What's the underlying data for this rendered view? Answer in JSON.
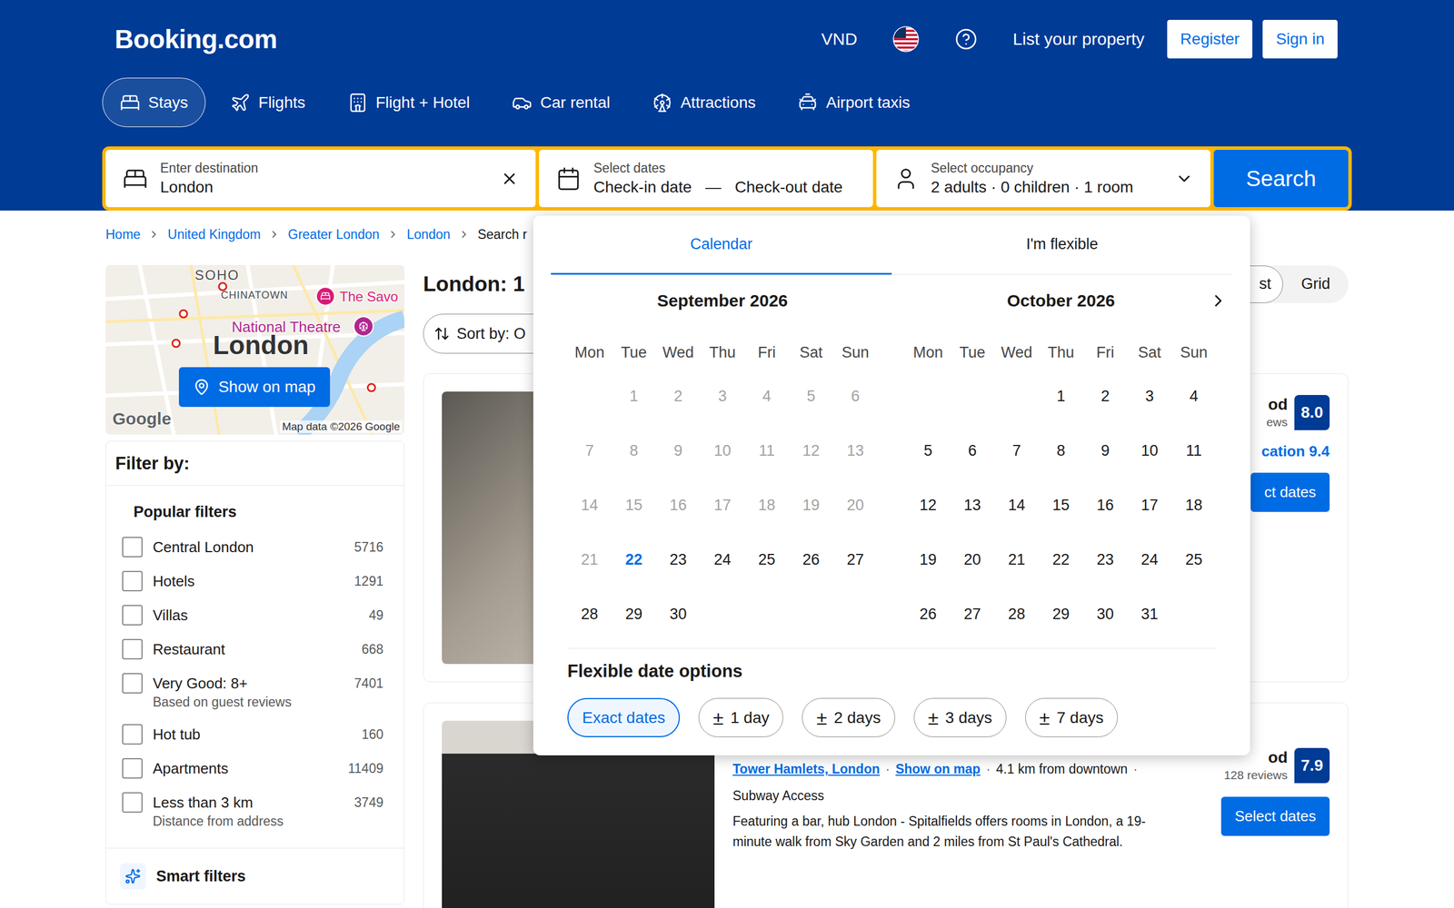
{
  "header": {
    "logo": "Booking.com",
    "currency": "VND",
    "list_property": "List your property",
    "buttons": [
      "Register",
      "Sign in"
    ]
  },
  "nav": [
    {
      "label": "Stays",
      "selected": true
    },
    {
      "label": "Flights",
      "selected": false
    },
    {
      "label": "Flight + Hotel",
      "selected": false
    },
    {
      "label": "Car rental",
      "selected": false
    },
    {
      "label": "Attractions",
      "selected": false
    },
    {
      "label": "Airport taxis",
      "selected": false
    }
  ],
  "search": {
    "destination": {
      "label": "Enter destination",
      "value": "London"
    },
    "dates": {
      "label": "Select dates",
      "checkin": "Check-in date",
      "separator": "—",
      "checkout": "Check-out date"
    },
    "occupancy": {
      "label": "Select occupancy",
      "value": "2 adults · 0 children · 1 room"
    },
    "button": "Search"
  },
  "breadcrumb": [
    "Home",
    "United Kingdom",
    "Greater London",
    "London",
    "Search r"
  ],
  "map": {
    "area_labels": [
      {
        "text": "SOHO"
      },
      {
        "text": "CHINATOWN"
      }
    ],
    "places": [
      {
        "text": "The Savo",
        "color": "#d81b78"
      },
      {
        "text": "National Theatre",
        "color": "#b0268f"
      }
    ],
    "city": "London",
    "button": "Show on map",
    "brand": "Google",
    "attribution": "Map data ©2026 Google"
  },
  "filters": {
    "title": "Filter by:",
    "section": "Popular filters",
    "items": [
      {
        "label": "Central London",
        "count": "5716",
        "checked": false
      },
      {
        "label": "Hotels",
        "count": "1291",
        "checked": false
      },
      {
        "label": "Villas",
        "count": "49",
        "checked": false
      },
      {
        "label": "Restaurant",
        "count": "668",
        "checked": false
      },
      {
        "label": "Very Good: 8+",
        "count": "7401",
        "checked": false,
        "note": "Based on guest reviews"
      },
      {
        "label": "Hot tub",
        "count": "160",
        "checked": false
      },
      {
        "label": "Apartments",
        "count": "11409",
        "checked": false
      },
      {
        "label": "Less than 3 km",
        "count": "3749",
        "checked": false,
        "note": "Distance from address"
      }
    ],
    "smart": "Smart filters"
  },
  "results": {
    "title": "London: 1",
    "sort": "Sort by: O",
    "views": [
      {
        "label": "st",
        "selected": true
      },
      {
        "label": "Grid",
        "selected": false
      }
    ],
    "cards": [
      {
        "score_word": "od",
        "reviews": "ews",
        "score": "8.0",
        "sub_score": "cation 9.4",
        "button": "ct dates"
      },
      {
        "location": "Tower Hamlets, London",
        "map_link": "Show on map",
        "distance": "4.1 km from downtown",
        "separator": "·",
        "tag": "Subway Access",
        "description": "Featuring a bar, hub London - Spitalfields offers rooms in London, a 19-minute walk from Sky Garden and 2 miles from St Paul's Cathedral.",
        "score_word": "od",
        "reviews": "128 reviews",
        "score": "7.9",
        "button": "Select dates"
      }
    ]
  },
  "calendar": {
    "tabs": [
      {
        "label": "Calendar",
        "selected": true
      },
      {
        "label": "I'm flexible",
        "selected": false
      }
    ],
    "weekdays": [
      "Mon",
      "Tue",
      "Wed",
      "Thu",
      "Fri",
      "Sat",
      "Sun"
    ],
    "months": [
      {
        "title": "September 2026",
        "offset": 1,
        "days": [
          {
            "label": "1",
            "disabled": true,
            "today": false
          },
          {
            "label": "2",
            "disabled": true,
            "today": false
          },
          {
            "label": "3",
            "disabled": true,
            "today": false
          },
          {
            "label": "4",
            "disabled": true,
            "today": false
          },
          {
            "label": "5",
            "disabled": true,
            "today": false
          },
          {
            "label": "6",
            "disabled": true,
            "today": false
          },
          {
            "label": "7",
            "disabled": true,
            "today": false
          },
          {
            "label": "8",
            "disabled": true,
            "today": false
          },
          {
            "label": "9",
            "disabled": true,
            "today": false
          },
          {
            "label": "10",
            "disabled": true,
            "today": false
          },
          {
            "label": "11",
            "disabled": true,
            "today": false
          },
          {
            "label": "12",
            "disabled": true,
            "today": false
          },
          {
            "label": "13",
            "disabled": true,
            "today": false
          },
          {
            "label": "14",
            "disabled": true,
            "today": false
          },
          {
            "label": "15",
            "disabled": true,
            "today": false
          },
          {
            "label": "16",
            "disabled": true,
            "today": false
          },
          {
            "label": "17",
            "disabled": true,
            "today": false
          },
          {
            "label": "18",
            "disabled": true,
            "today": false
          },
          {
            "label": "19",
            "disabled": true,
            "today": false
          },
          {
            "label": "20",
            "disabled": true,
            "today": false
          },
          {
            "label": "21",
            "disabled": true,
            "today": false
          },
          {
            "label": "22",
            "disabled": false,
            "today": true
          },
          {
            "label": "23",
            "disabled": false,
            "today": false
          },
          {
            "label": "24",
            "disabled": false,
            "today": false
          },
          {
            "label": "25",
            "disabled": false,
            "today": false
          },
          {
            "label": "26",
            "disabled": false,
            "today": false
          },
          {
            "label": "27",
            "disabled": false,
            "today": false
          },
          {
            "label": "28",
            "disabled": false,
            "today": false
          },
          {
            "label": "29",
            "disabled": false,
            "today": false
          },
          {
            "label": "30",
            "disabled": false,
            "today": false
          }
        ]
      },
      {
        "title": "October 2026",
        "offset": 3,
        "days": [
          {
            "label": "1",
            "disabled": false,
            "today": false
          },
          {
            "label": "2",
            "disabled": false,
            "today": false
          },
          {
            "label": "3",
            "disabled": false,
            "today": false
          },
          {
            "label": "4",
            "disabled": false,
            "today": false
          },
          {
            "label": "5",
            "disabled": false,
            "today": false
          },
          {
            "label": "6",
            "disabled": false,
            "today": false
          },
          {
            "label": "7",
            "disabled": false,
            "today": false
          },
          {
            "label": "8",
            "disabled": false,
            "today": false
          },
          {
            "label": "9",
            "disabled": false,
            "today": false
          },
          {
            "label": "10",
            "disabled": false,
            "today": false
          },
          {
            "label": "11",
            "disabled": false,
            "today": false
          },
          {
            "label": "12",
            "disabled": false,
            "today": false
          },
          {
            "label": "13",
            "disabled": false,
            "today": false
          },
          {
            "label": "14",
            "disabled": false,
            "today": false
          },
          {
            "label": "15",
            "disabled": false,
            "today": false
          },
          {
            "label": "16",
            "disabled": false,
            "today": false
          },
          {
            "label": "17",
            "disabled": false,
            "today": false
          },
          {
            "label": "18",
            "disabled": false,
            "today": false
          },
          {
            "label": "19",
            "disabled": false,
            "today": false
          },
          {
            "label": "20",
            "disabled": false,
            "today": false
          },
          {
            "label": "21",
            "disabled": false,
            "today": false
          },
          {
            "label": "22",
            "disabled": false,
            "today": false
          },
          {
            "label": "23",
            "disabled": false,
            "today": false
          },
          {
            "label": "24",
            "disabled": false,
            "today": false
          },
          {
            "label": "25",
            "disabled": false,
            "today": false
          },
          {
            "label": "26",
            "disabled": false,
            "today": false
          },
          {
            "label": "27",
            "disabled": false,
            "today": false
          },
          {
            "label": "28",
            "disabled": false,
            "today": false
          },
          {
            "label": "29",
            "disabled": false,
            "today": false
          },
          {
            "label": "30",
            "disabled": false,
            "today": false
          },
          {
            "label": "31",
            "disabled": false,
            "today": false
          }
        ]
      }
    ],
    "flexible": {
      "title": "Flexible date options",
      "chips": [
        {
          "label": "Exact dates",
          "selected": true
        },
        {
          "sign": "±",
          "label": "1 day",
          "selected": false
        },
        {
          "sign": "±",
          "label": "2 days",
          "selected": false
        },
        {
          "sign": "±",
          "label": "3 days",
          "selected": false
        },
        {
          "sign": "±",
          "label": "7 days",
          "selected": false
        }
      ]
    }
  }
}
